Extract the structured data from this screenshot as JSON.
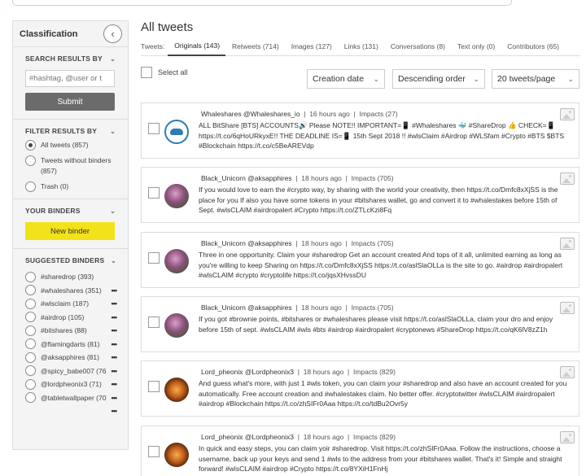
{
  "sidebar": {
    "title": "Classification",
    "collapse_icon": "‹",
    "search": {
      "heading": "SEARCH RESULTS BY",
      "placeholder": "#hashtag, @user or t",
      "submit_label": "Submit"
    },
    "filter": {
      "heading": "FILTER RESULTS BY",
      "options": [
        {
          "label": "All tweets (857)",
          "selected": true
        },
        {
          "label": "Tweets without binders (857)",
          "selected": false
        },
        {
          "label": "Trash (0)",
          "selected": false
        }
      ]
    },
    "binders": {
      "heading": "YOUR BINDERS",
      "new_label": "New binder"
    },
    "suggested": {
      "heading": "SUGGESTED BINDERS",
      "items": [
        {
          "label": "#sharedrop (393)",
          "more": ""
        },
        {
          "label": "#whaleshares (351)",
          "more": "•••"
        },
        {
          "label": "#wlsclaim (187)",
          "more": "•••"
        },
        {
          "label": "#airdrop (105)",
          "more": "•••"
        },
        {
          "label": "#bitshares (88)",
          "more": "•••"
        },
        {
          "label": "@flamingdarts (81)",
          "more": "•••"
        },
        {
          "label": "@aksapphires (81)",
          "more": "•••"
        },
        {
          "label": "@spicy_babe007 (76)",
          "more": "•••"
        },
        {
          "label": "@lordpheonix3 (71)",
          "more": "•••"
        },
        {
          "label": "@tabletwallpaper (70)",
          "more": "•••"
        }
      ],
      "trailing_more": "•••"
    }
  },
  "main": {
    "title": "All tweets",
    "tabs_label": "Tweets:",
    "tabs": [
      {
        "label": "Originals (143)",
        "active": true
      },
      {
        "label": "Retweets (714)"
      },
      {
        "label": "Images (127)"
      },
      {
        "label": "Links (131)"
      },
      {
        "label": "Conversations (8)"
      },
      {
        "label": "Text only (0)"
      },
      {
        "label": "Contributors (65)"
      }
    ],
    "select_all": "Select all",
    "dropdowns": {
      "sort_by": "Creation date",
      "order": "Descending order",
      "per_page": "20 tweets/page"
    },
    "tweets": [
      {
        "author": "Whaleshares @Whaleshares_io",
        "time": "16 hours ago",
        "impacts": "Impacts (27)",
        "avatar": "whale",
        "text": "ALL BitShare [BTS] ACCOUNTS🔊 Please NOTE!! IMPORTANT=📱 #Whaleshares 🐳 #ShareDrop 👍 CHECK=📱 https://t.co/6qHoURkyxE!! THE DEADLINE IS=📱 15th Sept 2018 !! #wlsClaim #Airdrop #WLSfam #Crypto #BTS $BTS #Blockchain https://t.co/c5BeAREVdp"
      },
      {
        "author": "Black_Unicorn @aksapphires",
        "time": "18 hours ago",
        "impacts": "Impacts (705)",
        "avatar": "unicorn",
        "text": "If you would love to earn the #crypto way, by sharing with the world your creativity, then https://t.co/Dmfc8xXjSS is the place for you If also you have some tokens in your #bitshares wallet, go and convert it to #whalestakes before 15th of Sept. #wlsCLAIM #airdropalert #Crypto https://t.co/ZTLcKzi8Fq"
      },
      {
        "author": "Black_Unicorn @aksapphires",
        "time": "18 hours ago",
        "impacts": "Impacts (705)",
        "avatar": "unicorn",
        "text": "Three in one opportunity. Claim your #sharedrop Get an account created And tops of it all, unlimited earning as long as you're willing to keep Sharing on https://t.co/Dmfc8xXjSS https://t.co/aslSlaOLLa is the site to go. #airdrop #airdropalert #wlsCLAIM #crypto #cryptolife https://t.co/jqsXHvssDU"
      },
      {
        "author": "Black_Unicorn @aksapphires",
        "time": "18 hours ago",
        "impacts": "Impacts (705)",
        "avatar": "unicorn",
        "text": "If you got #brownie points, #bitshares or #whaleshares please visit https://t.co/aslSlaOLLa, claim your dro and enjoy before 15th of sept. #wlsCLAIM #wls #bts #airdrop #airdropalert #cryptonews #ShareDrop https://t.co/qK6lV8zZ1h"
      },
      {
        "author": "Lord_pheonix @Lordpheonix3",
        "time": "18 hours ago",
        "impacts": "Impacts (829)",
        "avatar": "pheonix",
        "text": "And guess what's more, with just 1 #wls token, you can claim your #sharedrop and also have an account created for you automatically. Free account creation and #whalestakes claim. No better offer. #cryptotwitter #wlsCLAIM #airdropalert #airdrop #Blockchain https://t.co/zhSIFr0Aaa https://t.co/tdBu2Ovr5y"
      },
      {
        "author": "Lord_pheonix @Lordpheonix3",
        "time": "18 hours ago",
        "impacts": "Impacts (829)",
        "avatar": "pheonix",
        "text": "In quick and easy steps, you can claim yoir #sharedrop. Visit https://t.co/zhSIFr0Aaa. Follow the instructions, choose a username, back up your keys and send 1 #wls to the address from your #bitshares wallet. That's it! Simple and straight forward! #wlsCLAIM #airdrop #Crypto https://t.co/8YXiH1FnHj"
      }
    ]
  }
}
